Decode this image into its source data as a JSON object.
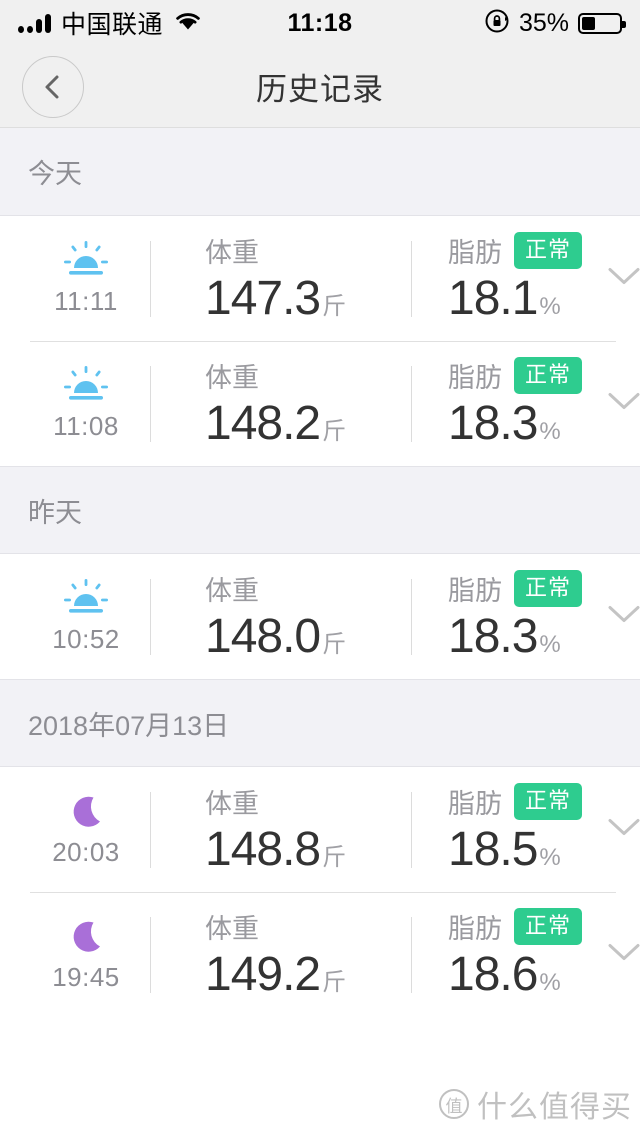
{
  "status_bar": {
    "carrier": "中国联通",
    "time": "11:18",
    "battery_percent": "35%",
    "signal_icon": "signal-bars-icon",
    "wifi_icon": "wifi-icon",
    "rotation_lock_icon": "rotation-lock-icon",
    "battery_icon": "battery-icon",
    "battery_level": 35
  },
  "nav": {
    "title": "历史记录",
    "back_icon": "chevron-left-icon"
  },
  "colors": {
    "badge_green": "#2ecc8f",
    "sunrise_blue": "#5fc2f0",
    "moon_purple": "#a96fd8",
    "section_bg": "#f2f2f6",
    "value_text": "#333333",
    "label_text": "#9a9a9f"
  },
  "labels": {
    "weight": "体重",
    "fat": "脂肪",
    "weight_unit": "斤",
    "fat_unit": "%",
    "expand_icon": "chevron-down-icon"
  },
  "sections": [
    {
      "title": "今天",
      "rows": [
        {
          "daypart_icon": "sunrise-icon",
          "time": "11:11",
          "weight_label": "体重",
          "weight_value": "147.3",
          "weight_unit": "斤",
          "fat_label": "脂肪",
          "fat_badge": "正常",
          "fat_value": "18.1",
          "fat_unit": "%"
        },
        {
          "daypart_icon": "sunrise-icon",
          "time": "11:08",
          "weight_label": "体重",
          "weight_value": "148.2",
          "weight_unit": "斤",
          "fat_label": "脂肪",
          "fat_badge": "正常",
          "fat_value": "18.3",
          "fat_unit": "%"
        }
      ]
    },
    {
      "title": "昨天",
      "rows": [
        {
          "daypart_icon": "sunrise-icon",
          "time": "10:52",
          "weight_label": "体重",
          "weight_value": "148.0",
          "weight_unit": "斤",
          "fat_label": "脂肪",
          "fat_badge": "正常",
          "fat_value": "18.3",
          "fat_unit": "%"
        }
      ]
    },
    {
      "title": "2018年07月13日",
      "rows": [
        {
          "daypart_icon": "moon-icon",
          "time": "20:03",
          "weight_label": "体重",
          "weight_value": "148.8",
          "weight_unit": "斤",
          "fat_label": "脂肪",
          "fat_badge": "正常",
          "fat_value": "18.5",
          "fat_unit": "%"
        },
        {
          "daypart_icon": "moon-icon",
          "time": "19:45",
          "weight_label": "体重",
          "weight_value": "149.2",
          "weight_unit": "斤",
          "fat_label": "脂肪",
          "fat_badge": "正常",
          "fat_value": "18.6",
          "fat_unit": "%"
        }
      ]
    }
  ],
  "watermark": {
    "logo": "值",
    "text": "什么值得买"
  }
}
